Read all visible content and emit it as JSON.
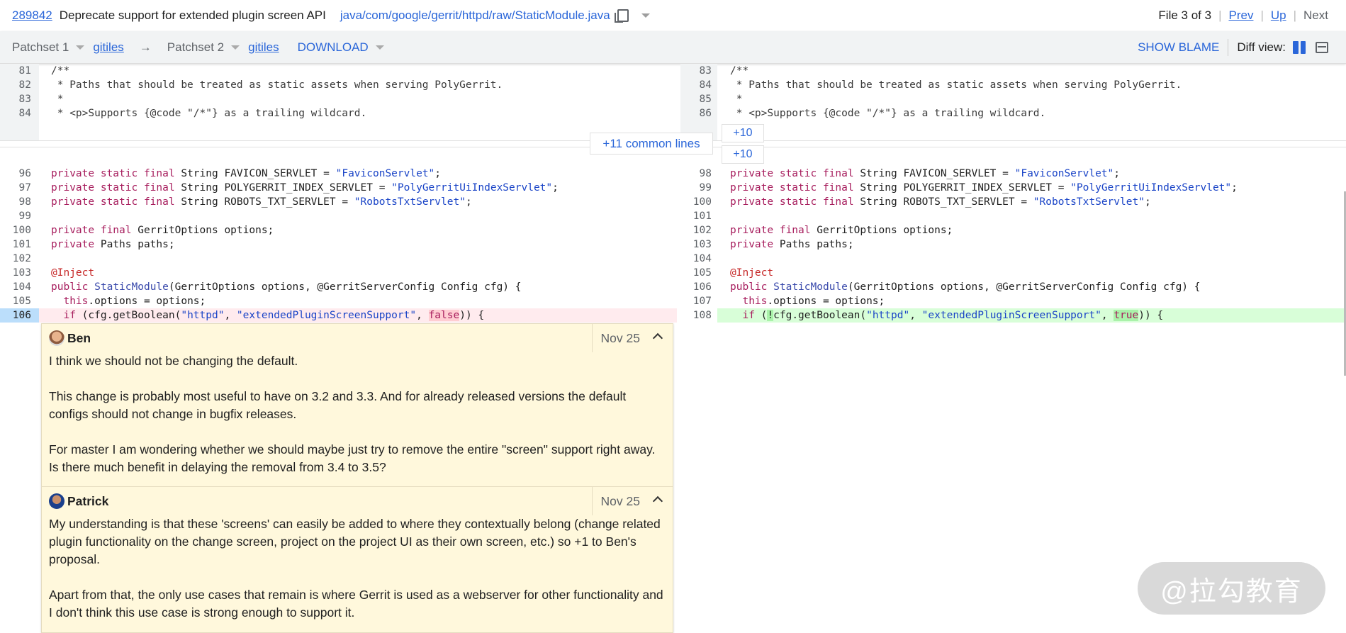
{
  "header": {
    "change_number": "289842",
    "subject": "Deprecate support for extended plugin screen API",
    "file_path": "java/com/google/gerrit/httpd/raw/StaticModule.java",
    "file_position": "File 3 of 3",
    "prev_label": "Prev",
    "up_label": "Up",
    "next_label": "Next"
  },
  "toolbar": {
    "left_patchset": "Patchset 1",
    "left_link": "gitiles",
    "arrow": "→",
    "right_patchset": "Patchset 2",
    "right_link": "gitiles",
    "download_label": "DOWNLOAD",
    "show_blame_label": "SHOW BLAME",
    "diff_view_label": "Diff view:"
  },
  "diff": {
    "common_lines_label": "+11 common lines",
    "expand_label": "+10",
    "left_top_numbers": [
      "81",
      "82",
      "83",
      "84"
    ],
    "right_top_numbers": [
      "83",
      "84",
      "85",
      "86"
    ],
    "top_lines": [
      "/**",
      " * Paths that should be treated as static assets when serving PolyGerrit.",
      " *",
      " * <p>Supports {@code \"/*\"} as a trailing wildcard."
    ],
    "left_bottom_numbers": [
      "96",
      "97",
      "98",
      "99",
      "100",
      "101",
      "102",
      "103",
      "104",
      "105",
      "106"
    ],
    "right_bottom_numbers": [
      "98",
      "99",
      "100",
      "101",
      "102",
      "103",
      "104",
      "105",
      "106",
      "107",
      "108"
    ],
    "favicon_const": "FAVICON_SERVLET",
    "favicon_value": "\"FaviconServlet\"",
    "index_const": "POLYGERRIT_INDEX_SERVLET",
    "index_value": "\"PolyGerritUiIndexServlet\"",
    "robots_const": "ROBOTS_TXT_SERVLET",
    "robots_value": "\"RobotsTxtServlet\"",
    "options_field": "GerritOptions options;",
    "paths_field": "Paths paths;",
    "inject": "@Inject",
    "ctor_name": "StaticModule",
    "ctor_params": "(GerritOptions options, @GerritServerConfig Config cfg) {",
    "assign": ".options = options;",
    "httpd": "\"httpd\"",
    "ext_key": "\"extendedPluginScreenSupport\"",
    "old_default": "false",
    "new_default": "true"
  },
  "comments": [
    {
      "author": "Ben",
      "date": "Nov 25",
      "paragraphs": [
        "I think we should not be changing the default.",
        "This change is probably most useful to have on 3.2 and 3.3. And for already released versions the default configs should not change in bugfix releases.",
        "For master I am wondering whether we should maybe just try to remove the entire \"screen\" support right away. Is there much benefit in delaying the removal from 3.4 to 3.5?"
      ]
    },
    {
      "author": "Patrick",
      "date": "Nov 25",
      "paragraphs": [
        "My understanding is that these 'screens' can easily be added to where they contextually belong (change related plugin functionality on the change screen, project on the project UI as their own screen, etc.) so +1 to Ben's proposal.",
        "Apart from that, the only use cases that remain is where Gerrit is used as a webserver for other functionality and I don't think this use case is strong enough to support it."
      ]
    }
  ],
  "watermark": "@拉勾教育"
}
